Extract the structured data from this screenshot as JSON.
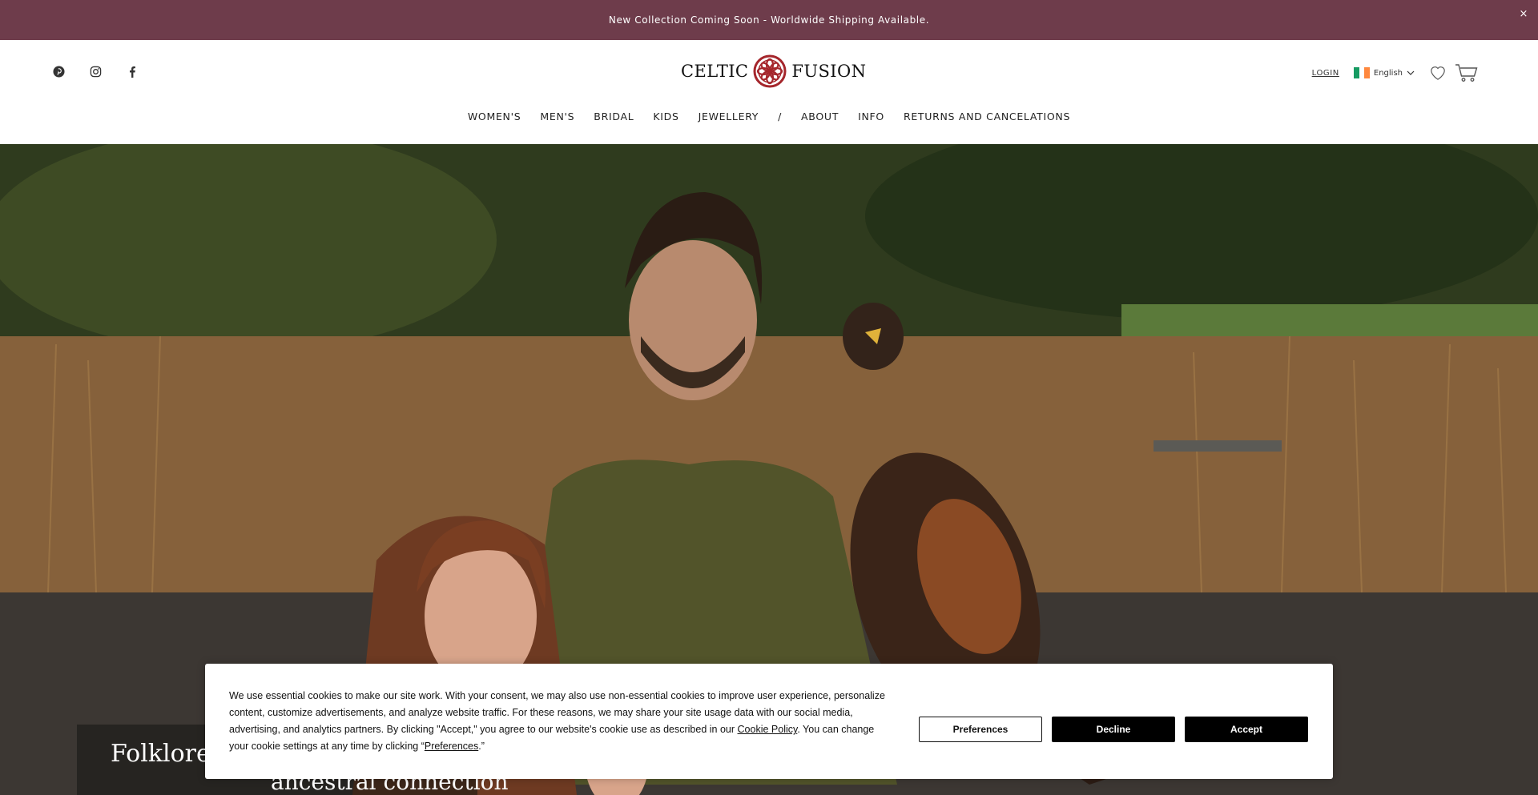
{
  "announcement": {
    "text": "New Collection Coming Soon - Worldwide Shipping Available.",
    "close": "×"
  },
  "header": {
    "logo_left": "CELTIC",
    "logo_right": "FUSION",
    "login": "LOGIN",
    "language": "English"
  },
  "nav": {
    "items": [
      "WOMEN'S",
      "MEN'S",
      "BRIDAL",
      "KIDS",
      "JEWELLERY",
      "/",
      "ABOUT",
      "INFO",
      "RETURNS AND CANCELATIONS"
    ]
  },
  "hero": {
    "title": "Folklore",
    "subtitle": "ancestral connection"
  },
  "cookie": {
    "text_1": "We use essential cookies to make our site work. With your consent, we may also use non-essential cookies to improve user experience, personalize content, customize advertisements, and analyze website traffic. For these reasons, we may share your site usage data with our social media, advertising, and analytics partners. By clicking \"Accept,\" you agree to our website's cookie use as described in our ",
    "policy_link": "Cookie Policy",
    "text_2": ". You can change your cookie settings at any time by clicking “",
    "preferences_link": "Preferences",
    "text_3": ".”",
    "preferences_button": "Preferences",
    "decline_button": "Decline",
    "accept_button": "Accept"
  },
  "colors": {
    "announcement_bg": "#6e3c4b",
    "logo_accent": "#a5262c",
    "flag": [
      "#169b62",
      "#ffffff",
      "#ff883e"
    ]
  },
  "icons": [
    "pinterest-icon",
    "instagram-icon",
    "facebook-icon",
    "chevron-down-icon",
    "heart-icon",
    "cart-icon",
    "close-icon",
    "celtic-knot-logo-icon"
  ]
}
